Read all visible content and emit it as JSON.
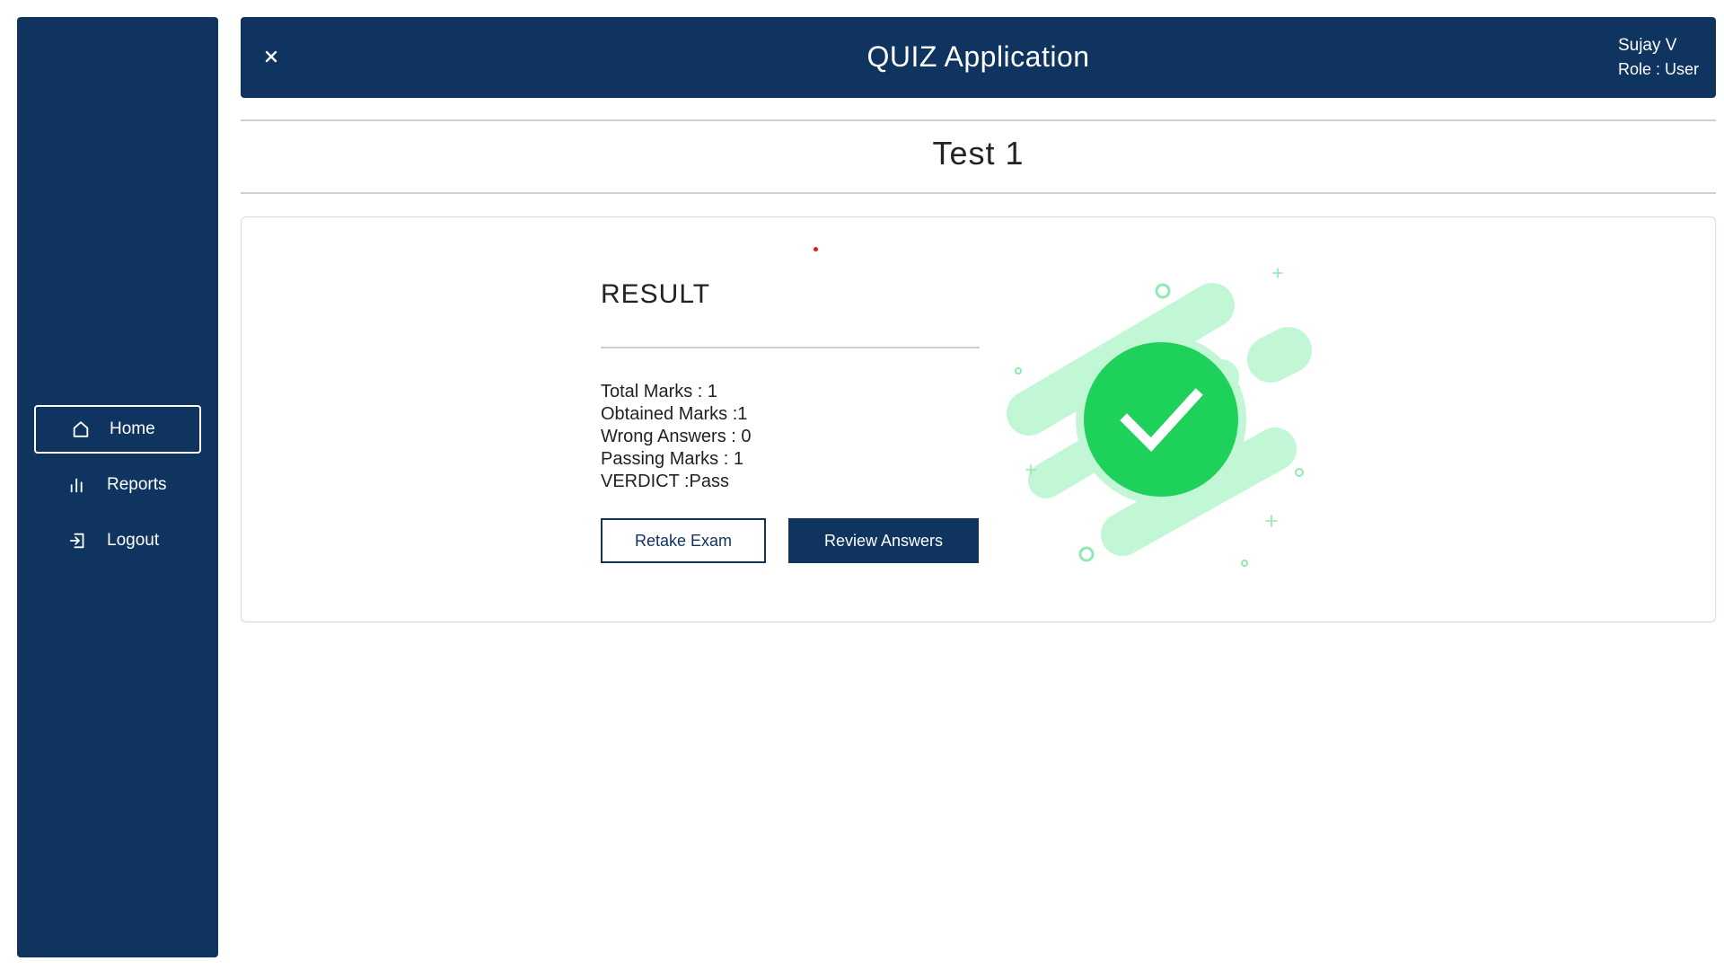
{
  "header": {
    "close_icon": "close-icon",
    "title": "QUIZ Application",
    "user_name": "Sujay V",
    "role": "Role : User"
  },
  "sidebar": {
    "items": [
      {
        "label": "Home",
        "icon": "home-icon",
        "active": true
      },
      {
        "label": "Reports",
        "icon": "bar-chart-icon",
        "active": false
      },
      {
        "label": "Logout",
        "icon": "logout-icon",
        "active": false
      }
    ]
  },
  "page": {
    "title": "Test 1"
  },
  "result": {
    "heading": "RESULT",
    "total_marks": "Total Marks : 1",
    "obtained_marks": "Obtained Marks :1",
    "wrong_answers": "Wrong Answers : 0",
    "passing_marks": "Passing Marks : 1",
    "verdict": "VERDICT :Pass",
    "retake_label": "Retake Exam",
    "review_label": "Review Answers",
    "illustration_icon": "success-check-icon"
  },
  "colors": {
    "primary": "#0f3460",
    "success": "#1ed15a",
    "success_light": "#c2f7d6",
    "marker": "#e01919"
  }
}
